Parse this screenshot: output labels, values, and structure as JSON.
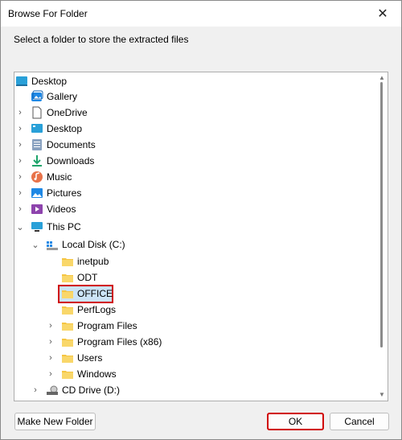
{
  "window": {
    "title": "Browse For Folder",
    "close_glyph": "✕"
  },
  "instruction": "Select a folder to store the extracted files",
  "tree": {
    "items": [
      {
        "label": "Desktop",
        "icon": "desktop-icon"
      },
      {
        "label": "Gallery",
        "icon": "gallery-icon"
      },
      {
        "label": "OneDrive",
        "icon": "onedrive-icon"
      },
      {
        "label": "Desktop",
        "icon": "desktop-icon"
      },
      {
        "label": "Documents",
        "icon": "documents-icon"
      },
      {
        "label": "Downloads",
        "icon": "downloads-icon"
      },
      {
        "label": "Music",
        "icon": "music-icon"
      },
      {
        "label": "Pictures",
        "icon": "pictures-icon"
      },
      {
        "label": "Videos",
        "icon": "videos-icon"
      },
      {
        "label": "This PC",
        "icon": "this-pc-icon"
      },
      {
        "label": "Local Disk (C:)",
        "icon": "local-disk-icon"
      },
      {
        "label": "inetpub",
        "icon": "folder-icon"
      },
      {
        "label": "ODT",
        "icon": "folder-icon"
      },
      {
        "label": "OFFICE",
        "icon": "folder-icon",
        "selected": true
      },
      {
        "label": "PerfLogs",
        "icon": "folder-icon"
      },
      {
        "label": "Program Files",
        "icon": "folder-icon"
      },
      {
        "label": "Program Files (x86)",
        "icon": "folder-icon"
      },
      {
        "label": "Users",
        "icon": "folder-icon"
      },
      {
        "label": "Windows",
        "icon": "folder-icon"
      },
      {
        "label": "CD Drive (D:)",
        "icon": "cd-drive-icon"
      }
    ]
  },
  "buttons": {
    "make_new_folder": "Make New Folder",
    "ok": "OK",
    "cancel": "Cancel"
  },
  "colors": {
    "highlight_border": "#d00000",
    "folder_yellow": "#f5c542",
    "accent_blue": "#1e88e5"
  }
}
